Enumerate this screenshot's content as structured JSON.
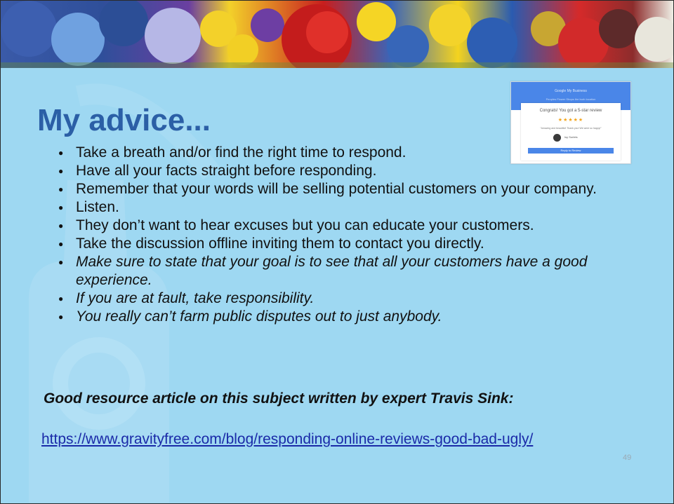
{
  "slide": {
    "title": "My advice...",
    "bullets": [
      {
        "text": "Take a breath and/or find the right time to respond.",
        "italic": false
      },
      {
        "text": "Have all your facts straight before responding.",
        "italic": false
      },
      {
        "text": "Remember that your words will be selling potential customers on your company.",
        "italic": false
      },
      {
        "text": "Listen.",
        "italic": false
      },
      {
        "text": "They don’t want to hear excuses but you can educate your customers.",
        "italic": false
      },
      {
        "text": "Take the discussion offline inviting them to contact you directly.",
        "italic": false
      },
      {
        "text": "Make sure to state that your goal is to see that all your customers have a good experience.",
        "italic": true
      },
      {
        "text": "If you are at fault, take responsibility.",
        "italic": true
      },
      {
        "text": "You really can’t farm public disputes out to just anybody.",
        "italic": true
      }
    ],
    "resource_label": "Good resource article on this subject written by expert Travis Sink:",
    "link_text": "https://www.gravityfree.com/blog/responding-online-reviews-good-bad-ugly/",
    "page_number": "49"
  },
  "screenshot": {
    "header_title": "Google My Business",
    "header_subtitle": "Peoples Flower Shops the burb location",
    "card_title": "Congrats! You got a 5-star review",
    "stars": "★★★★★",
    "quote": "\"Amazing and beautiful! Thank you! We were so happy!\"",
    "reviewer": "Isy Surlets",
    "button": "Reply to Review"
  },
  "colors": {
    "background": "#9ed8f2",
    "title": "#2b5fa6",
    "link": "#1a2aa8",
    "google_blue": "#4a86e8",
    "star": "#f3a51c"
  }
}
